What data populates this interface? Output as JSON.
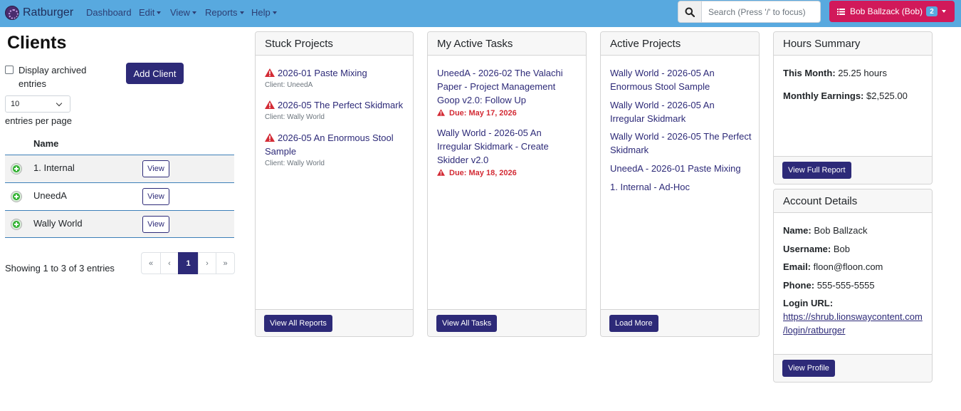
{
  "navbar": {
    "brand": "Ratburger",
    "items": [
      {
        "label": "Dashboard",
        "dropdown": false
      },
      {
        "label": "Edit",
        "dropdown": true
      },
      {
        "label": "View",
        "dropdown": true
      },
      {
        "label": "Reports",
        "dropdown": true
      },
      {
        "label": "Help",
        "dropdown": true
      }
    ],
    "search_placeholder": "Search (Press '/' to focus)",
    "user_label": "Bob Ballzack (Bob)",
    "user_badge": "2",
    "color_bg": "#58a9df",
    "color_user": "#d1195a"
  },
  "clients": {
    "title": "Clients",
    "archived_label": "Display archived entries",
    "add_client_label": "Add Client",
    "page_size": "10",
    "entries_label": "entries per page",
    "column_name": "Name",
    "rows": [
      {
        "name": "1. Internal",
        "view_label": "View"
      },
      {
        "name": "UneedA",
        "view_label": "View"
      },
      {
        "name": "Wally World",
        "view_label": "View"
      }
    ],
    "showing": "Showing 1 to 3 of 3 entries",
    "pager": [
      "«",
      "‹",
      "1",
      "›",
      "»"
    ]
  },
  "stuck_projects": {
    "title": "Stuck Projects",
    "items": [
      {
        "name": "2026-01 Paste Mixing",
        "client": "Client: UneedA"
      },
      {
        "name": "2026-05 The Perfect Skidmark",
        "client": "Client: Wally World"
      },
      {
        "name": "2026-05 An Enormous Stool Sample",
        "client": "Client: Wally World"
      }
    ],
    "footer_button": "View All Reports"
  },
  "active_tasks": {
    "title": "My Active Tasks",
    "items": [
      {
        "name": "UneedA - 2026-02 The Valachi Paper - Project Management Goop v2.0: Follow Up",
        "due": "Due: May 17, 2026"
      },
      {
        "name": "Wally World - 2026-05 An Irregular Skidmark - Create Skidder v2.0",
        "due": "Due: May 18, 2026"
      }
    ],
    "footer_button": "View All Tasks"
  },
  "active_projects": {
    "title": "Active Projects",
    "items": [
      "Wally World - 2026-05 An Enormous Stool Sample",
      "Wally World - 2026-05 An Irregular Skidmark",
      "Wally World - 2026-05 The Perfect Skidmark",
      "UneedA - 2026-01 Paste Mixing",
      "1. Internal - Ad-Hoc"
    ],
    "footer_button": "Load More"
  },
  "hours_summary": {
    "title": "Hours Summary",
    "this_month_label": "This Month:",
    "this_month_value": "25.25 hours",
    "earnings_label": "Monthly Earnings:",
    "earnings_value": "$2,525.00",
    "footer_button": "View Full Report"
  },
  "account_details": {
    "title": "Account Details",
    "name_label": "Name:",
    "name_value": "Bob Ballzack",
    "username_label": "Username:",
    "username_value": "Bob",
    "email_label": "Email:",
    "email_value": "floon@floon.com",
    "phone_label": "Phone:",
    "phone_value": "555-555-5555",
    "login_label": "Login URL:",
    "login_url_line1": "https://shrub.lionswaycontent.com",
    "login_url_line2": "/login/ratburger",
    "footer_button": "View Profile"
  },
  "colors": {
    "primary": "#2d2a78",
    "danger": "#d32b35",
    "link_border": "#3d7fb8"
  },
  "icons": [
    "ratburger-logo-icon",
    "chevron-down-icon",
    "search-icon",
    "list-icon",
    "expand-plus-icon",
    "warning-triangle-icon"
  ]
}
